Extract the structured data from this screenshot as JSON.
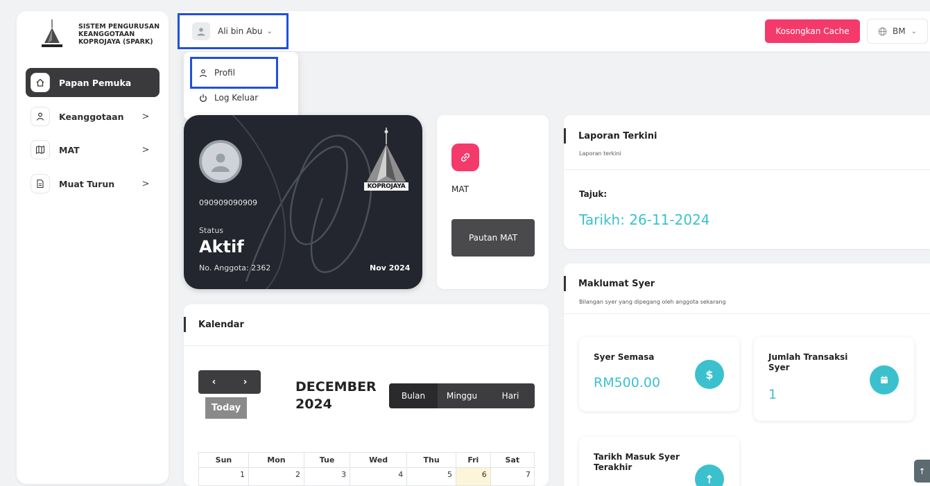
{
  "sidebar": {
    "brand_text": "SISTEM PENGURUSAN KEANGGOTAAN KOPROJAYA (SPARK)",
    "items": [
      {
        "label": "Papan Pemuka",
        "icon": "home-icon",
        "active": true
      },
      {
        "label": "Keanggotaan",
        "icon": "user-icon"
      },
      {
        "label": "MAT",
        "icon": "map-icon"
      },
      {
        "label": "Muat Turun",
        "icon": "file-icon"
      }
    ]
  },
  "topbar": {
    "user_name": "Ali bin Abu",
    "cache_button": "Kosongkan Cache",
    "language": "BM"
  },
  "dropdown": {
    "items": [
      {
        "label": "Profil",
        "icon": "user-icon"
      },
      {
        "label": "Log Keluar",
        "icon": "power-icon"
      }
    ]
  },
  "member_card": {
    "phone": "090909090909",
    "status_label": "Status",
    "status": "Aktif",
    "member_no": "No. Anggota: 2362",
    "date": "Nov 2024",
    "logo_text": "KOPROJAYA"
  },
  "mat_card": {
    "title": "MAT",
    "button": "Pautan MAT"
  },
  "calendar": {
    "title": "Kalendar",
    "prev": "‹",
    "next": "›",
    "today": "Today",
    "month": "DECEMBER 2024",
    "views": [
      "Bulan",
      "Minggu",
      "Hari"
    ],
    "weekdays": [
      "Sun",
      "Mon",
      "Tue",
      "Wed",
      "Thu",
      "Fri",
      "Sat"
    ],
    "first_row": [
      "1",
      "2",
      "3",
      "4",
      "5",
      "6",
      "7"
    ],
    "today_date": "6"
  },
  "report": {
    "title": "Laporan Terkini",
    "caption": "Laporan terkini",
    "tajuk": "Tajuk:",
    "date": "Tarikh: 26-11-2024"
  },
  "shares": {
    "title": "Maklumat Syer",
    "caption": "Bilangan syer yang dipegang oleh anggota sekarang",
    "current_label": "Syer Semasa",
    "current_value": "RM500.00",
    "transactions_label": "Jumlah Transaksi Syer",
    "transactions_value": "1",
    "last_entry_label": "Tarikh Masuk Syer Terakhir"
  },
  "colors": {
    "accent_pink": "#f43a6a",
    "accent_teal": "#3bc1cd",
    "dark": "#23262e",
    "highlight_blue": "#1f4fe0"
  }
}
